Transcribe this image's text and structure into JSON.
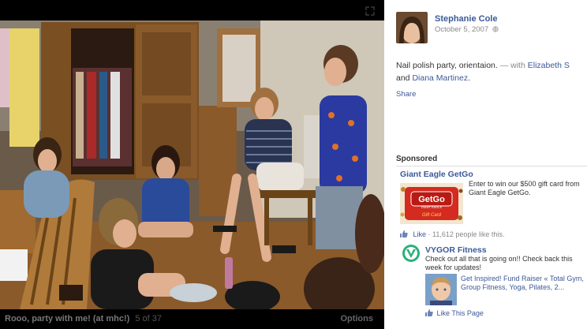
{
  "viewer": {
    "caption": "Rooo, party with me! (at mhc!)",
    "counter": "5 of 37",
    "options_label": "Options"
  },
  "post": {
    "author": "Stephanie Cole",
    "date": "October 5, 2007",
    "text": "Nail polish party, orientaion.",
    "with_prefix": "— with",
    "tagged_1": "Elizabeth S",
    "and_word": "and",
    "tagged_2": "Diana Martinez",
    "period": ".",
    "share_label": "Share"
  },
  "sponsored": {
    "heading": "Sponsored",
    "ad1": {
      "title": "Giant Eagle GetGo",
      "body": "Enter to win our $500 gift card from Giant Eagle GetGo.",
      "card_logo": "GetGo",
      "card_sub": "GIANT EAGLE",
      "card_label": "Gift Card",
      "like_label": "Like",
      "like_count": "· 11,612 people like this."
    },
    "ad2": {
      "title": "VYGOR Fitness",
      "body": "Check out all that is going on!! Check back this week for updates!",
      "sub_text": "Get Inspired! Fund Raiser « Total Gym, Group Fitness, Yoga, Pilates, 2...",
      "like_label": "Like This Page"
    }
  },
  "colors": {
    "link": "#3b5998",
    "viewer_bg": "#000000"
  },
  "icons": [
    "expand-icon",
    "globe-icon",
    "thumbs-up-icon",
    "vygor-logo-icon"
  ]
}
